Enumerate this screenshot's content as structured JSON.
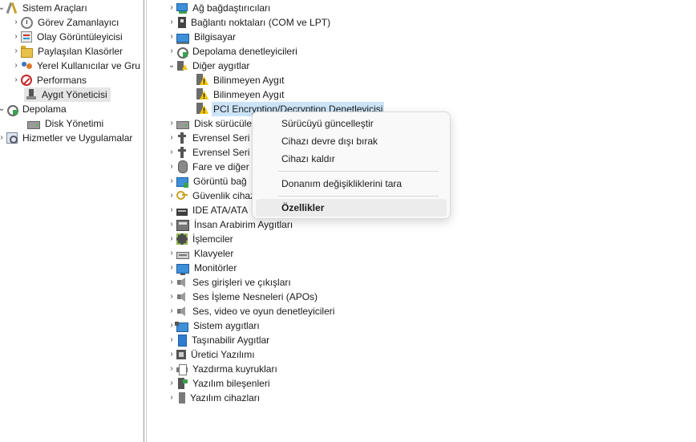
{
  "left_tree": {
    "items": [
      {
        "label": "Sistem Araçları",
        "arrow": "⌄",
        "icon": "tools-icon"
      },
      {
        "label": "Görev Zamanlayıcı",
        "arrow": "›",
        "icon": "clock-icon"
      },
      {
        "label": "Olay Görüntüleyicisi",
        "arrow": "›",
        "icon": "event-log-icon"
      },
      {
        "label": "Paylaşılan Klasörler",
        "arrow": "›",
        "icon": "shared-folder-icon"
      },
      {
        "label": "Yerel Kullanıcılar ve Gru",
        "arrow": "›",
        "icon": "users-icon"
      },
      {
        "label": "Performans",
        "arrow": "›",
        "icon": "performance-icon"
      },
      {
        "label": "Aygıt Yöneticisi",
        "arrow": "",
        "icon": "device-manager-icon"
      },
      {
        "label": "Depolama",
        "arrow": "⌄",
        "icon": "storage-icon"
      },
      {
        "label": "Disk Yönetimi",
        "arrow": "",
        "icon": "disk-icon"
      },
      {
        "label": "Hizmetler ve Uygulamalar",
        "arrow": "›",
        "icon": "services-icon"
      }
    ]
  },
  "device_tree": {
    "categories": [
      {
        "label": "Ağ bağdaştırıcıları",
        "arrow": "›",
        "icon": "network-adapter-icon"
      },
      {
        "label": "Bağlantı noktaları (COM ve LPT)",
        "arrow": "›",
        "icon": "port-icon"
      },
      {
        "label": "Bilgisayar",
        "arrow": "›",
        "icon": "computer-icon"
      },
      {
        "label": "Depolama denetleyicileri",
        "arrow": "›",
        "icon": "storage-controller-icon"
      },
      {
        "label": "Diğer aygıtlar",
        "arrow": "⌄",
        "icon": "other-devices-icon"
      },
      {
        "label": "Bilinmeyen Aygıt",
        "arrow": "",
        "icon": "unknown-device-warning-icon"
      },
      {
        "label": "Bilinmeyen Aygıt",
        "arrow": "",
        "icon": "unknown-device-warning-icon"
      },
      {
        "label": "PCI Encryption/Decryption Denetleyicisi",
        "arrow": "",
        "icon": "unknown-device-warning-icon"
      },
      {
        "label": "Disk sürücüle",
        "arrow": "›",
        "icon": "disk-drive-icon"
      },
      {
        "label": "Evrensel Seri",
        "arrow": "›",
        "icon": "usb-icon"
      },
      {
        "label": "Evrensel Seri",
        "arrow": "›",
        "icon": "usb-icon"
      },
      {
        "label": "Fare ve diğer",
        "arrow": "›",
        "icon": "mouse-icon"
      },
      {
        "label": "Görüntü bağ",
        "arrow": "›",
        "icon": "display-adapter-icon"
      },
      {
        "label": "Güvenlik cihaz",
        "arrow": "›",
        "icon": "security-device-icon"
      },
      {
        "label": "IDE ATA/ATA",
        "arrow": "›",
        "icon": "ide-controller-icon"
      },
      {
        "label": "İnsan Arabirim Aygıtları",
        "arrow": "›",
        "icon": "hid-icon"
      },
      {
        "label": "İşlemciler",
        "arrow": "›",
        "icon": "processor-icon"
      },
      {
        "label": "Klavyeler",
        "arrow": "›",
        "icon": "keyboard-icon"
      },
      {
        "label": "Monitörler",
        "arrow": "›",
        "icon": "monitor-icon"
      },
      {
        "label": "Ses girişleri ve çıkışları",
        "arrow": "›",
        "icon": "audio-io-icon"
      },
      {
        "label": "Ses İşleme Nesneleri (APOs)",
        "arrow": "›",
        "icon": "audio-processing-icon"
      },
      {
        "label": "Ses, video ve oyun denetleyicileri",
        "arrow": "›",
        "icon": "sound-video-game-icon"
      },
      {
        "label": "Sistem aygıtları",
        "arrow": "›",
        "icon": "system-devices-icon"
      },
      {
        "label": "Taşınabilir Aygıtlar",
        "arrow": "›",
        "icon": "portable-device-icon"
      },
      {
        "label": "Üretici Yazılımı",
        "arrow": "›",
        "icon": "firmware-icon"
      },
      {
        "label": "Yazdırma kuyrukları",
        "arrow": "›",
        "icon": "printer-icon"
      },
      {
        "label": "Yazılım bileşenleri",
        "arrow": "›",
        "icon": "software-component-icon"
      },
      {
        "label": "Yazılım cihazları",
        "arrow": "›",
        "icon": "software-device-icon"
      }
    ]
  },
  "context_menu": {
    "update_driver": "Sürücüyü güncelleştir",
    "disable_device": "Cihazı devre dışı bırak",
    "uninstall_device": "Cihazı kaldır",
    "scan_hardware": "Donanım değişikliklerini tara",
    "properties": "Özellikler"
  }
}
